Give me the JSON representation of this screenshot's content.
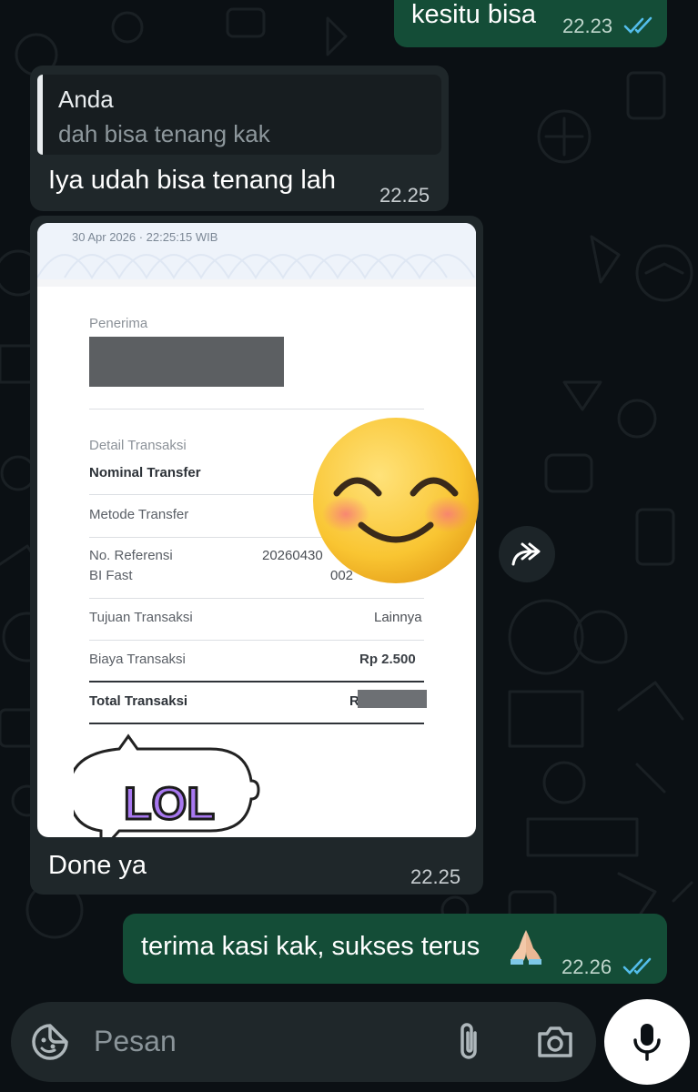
{
  "colors": {
    "outgoing_bubble": "#144d37",
    "incoming_bubble": "#1f272a",
    "read_ticks": "#53bdeb",
    "background": "#0b1014"
  },
  "messages": [
    {
      "direction": "outgoing",
      "text": "kesitu bisa",
      "time": "22.23",
      "status": "read"
    },
    {
      "direction": "incoming",
      "reply_to": {
        "author": "Anda",
        "text": "dah bisa tenang kak"
      },
      "text": "Iya udah bisa tenang lah",
      "time": "22.25"
    },
    {
      "direction": "incoming",
      "type": "image",
      "caption": "Done ya",
      "time": "22.25"
    },
    {
      "direction": "outgoing",
      "text": "terima kasi kak, sukses terus",
      "time": "22.26",
      "status": "read"
    }
  ],
  "receipt": {
    "datetime": "30 Apr 2026 · 22:25:15 WIB",
    "recipient_label": "Penerima",
    "detail_label": "Detail Transaksi",
    "nominal_label": "Nominal Transfer",
    "method_label": "Metode Transfer",
    "reference_label": "No. Referensi",
    "reference_sub": "BI Fast",
    "reference_value_1": "20260430",
    "reference_value_2": "002",
    "purpose_label": "Tujuan Transaksi",
    "purpose_value": "Lainnya",
    "fee_label": "Biaya Transaksi",
    "fee_value": "Rp 2.500",
    "total_label": "Total Transaksi",
    "total_value_prefix": "R",
    "stickers": {
      "lol": "LOL",
      "emoji": "smiling-blush-emoji"
    }
  },
  "composer": {
    "placeholder": "Pesan",
    "icons": [
      "sticker-icon",
      "attach-icon",
      "camera-icon",
      "mic-icon"
    ]
  },
  "forward_icon": "forward-icon"
}
